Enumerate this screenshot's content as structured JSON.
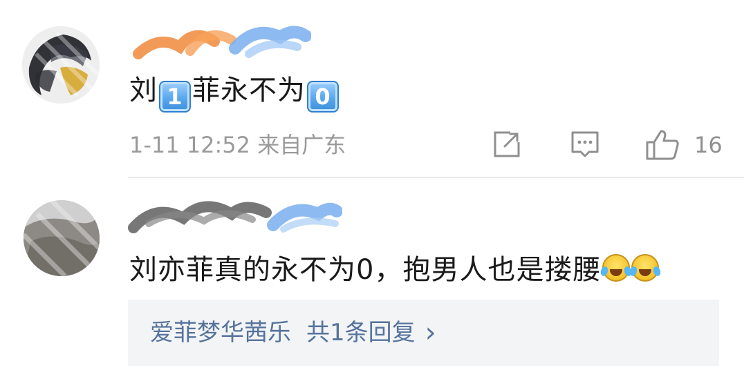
{
  "comments": [
    {
      "text_before": "刘",
      "keycap_1": "1",
      "text_middle": "菲永不为",
      "keycap_2": "0",
      "timestamp": "1-11 12:52",
      "location": "来自广东",
      "like_count": "16"
    },
    {
      "text": "刘亦菲真的永不为0，抱男人也是搂腰",
      "reply_author": "爱菲梦华茜乐",
      "reply_count_label": "共1条回复",
      "reply_arrow": "›"
    }
  ],
  "icons": {
    "share": "share-icon",
    "reply": "comment-icon",
    "like": "thumbs-up-icon",
    "emoji": "laughing-crying-emoji"
  },
  "colors": {
    "text": "#1a1a1a",
    "meta": "#9a9a9a",
    "link": "#56739b",
    "reply_bg": "#f3f4f6"
  }
}
